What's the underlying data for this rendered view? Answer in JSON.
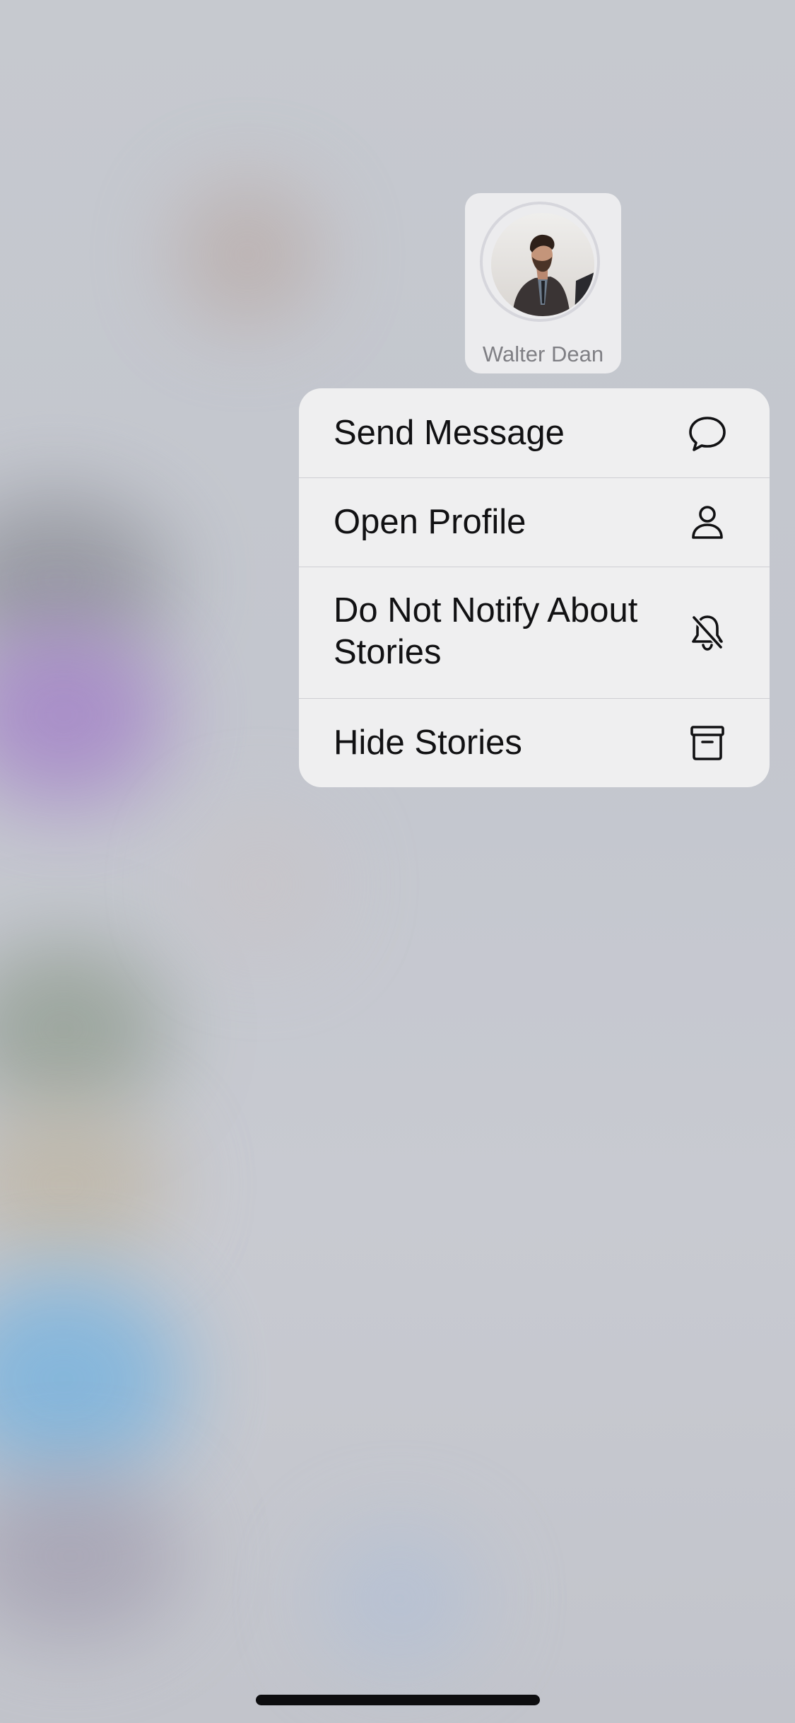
{
  "story_preview": {
    "name": "Walter Dean",
    "avatar": "profile-photo"
  },
  "context_menu": {
    "items": [
      {
        "label": "Send Message",
        "icon": "speech-bubble-icon"
      },
      {
        "label": "Open Profile",
        "icon": "person-icon"
      },
      {
        "label": "Do Not Notify About Stories",
        "icon": "bell-slash-icon"
      },
      {
        "label": "Hide Stories",
        "icon": "archive-box-icon"
      }
    ]
  },
  "colors": {
    "menu_background": "#efeff0",
    "separator": "#cfcfd3",
    "label_text": "#111113",
    "name_text": "#7f7f84"
  }
}
